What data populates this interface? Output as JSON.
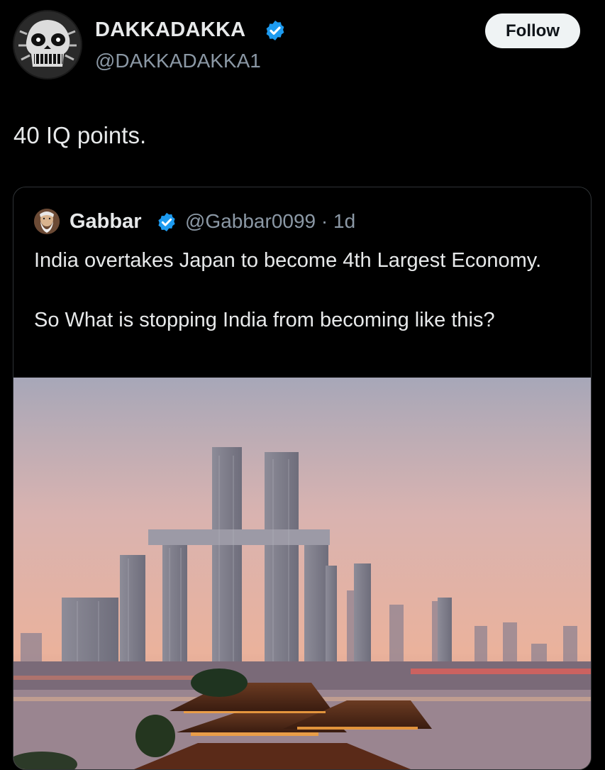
{
  "author": {
    "display_name": "DAKKADAKKA",
    "handle": "@DAKKADAKKA1",
    "verified": true,
    "avatar_icon": "skull-illustration-avatar"
  },
  "follow_button": {
    "label": "Follow"
  },
  "tweet": {
    "text": "40 IQ points."
  },
  "quoted_tweet": {
    "author_name": "Gabbar",
    "author_handle": "@Gabbar0099",
    "time": "· 1d",
    "verified": true,
    "lines": [
      "India overtakes Japan to become 4th Largest Economy.",
      "So What is stopping India from becoming like this?"
    ],
    "image_icon": "city-skyline-photo"
  },
  "colors": {
    "background": "#000000",
    "text": "#e7e9ea",
    "secondary_text": "#8b98a5",
    "verified_blue": "#1d9bf0",
    "card_border": "#2f3336"
  }
}
